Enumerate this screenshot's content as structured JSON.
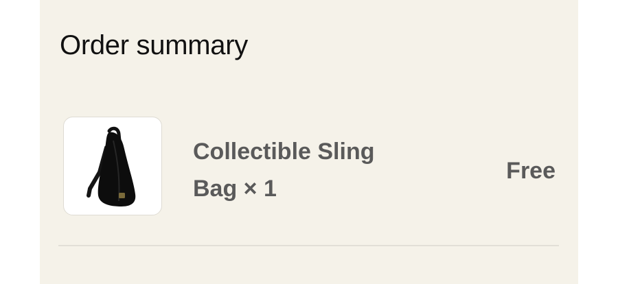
{
  "order_summary": {
    "title": "Order summary",
    "items": [
      {
        "image_icon": "black-sling-bag-thumbnail",
        "name": "Collectible Sling Bag × 1",
        "price": "Free"
      }
    ]
  },
  "colors": {
    "panel_background": "#f5f2e9",
    "title_text": "#111111",
    "secondary_text": "#5a5a5a",
    "divider": "#e2dfd7"
  }
}
